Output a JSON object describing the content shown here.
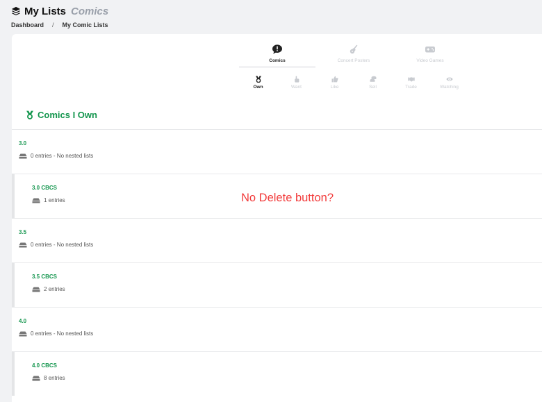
{
  "header": {
    "title": "My Lists",
    "subtitle": "Comics"
  },
  "breadcrumb": [
    "Dashboard",
    "/",
    "My Comic Lists"
  ],
  "categories": [
    {
      "label": "Comics",
      "icon": "comment-exclamation-icon",
      "active": true
    },
    {
      "label": "Concert Posters",
      "icon": "guitar-icon",
      "active": false
    },
    {
      "label": "Video Games",
      "icon": "gamepad-icon",
      "active": false
    }
  ],
  "subtabs": [
    {
      "label": "Own",
      "icon": "medal-icon",
      "active": true
    },
    {
      "label": "Want",
      "icon": "hand-pointer-icon",
      "active": false
    },
    {
      "label": "Like",
      "icon": "thumbs-up-icon",
      "active": false
    },
    {
      "label": "Sell",
      "icon": "coins-icon",
      "active": false
    },
    {
      "label": "Trade",
      "icon": "handshake-icon",
      "active": false
    },
    {
      "label": "Watching",
      "icon": "eye-icon",
      "active": false
    }
  ],
  "section_title": "Comics I Own",
  "lists": [
    {
      "name": "3.0",
      "meta": "0 entries - No nested lists",
      "nested": false
    },
    {
      "name": "3.0 CBCS",
      "meta": "1 entries",
      "nested": true
    },
    {
      "name": "3.5",
      "meta": "0 entries - No nested lists",
      "nested": false
    },
    {
      "name": "3.5 CBCS",
      "meta": "2 entries",
      "nested": true
    },
    {
      "name": "4.0",
      "meta": "0 entries - No nested lists",
      "nested": false
    },
    {
      "name": "4.0 CBCS",
      "meta": "8 entries",
      "nested": true
    }
  ],
  "annotation": "No Delete button?",
  "colors": {
    "accent": "#14964e",
    "annotation": "#f23b3b",
    "muted": "#c8cbd0"
  }
}
